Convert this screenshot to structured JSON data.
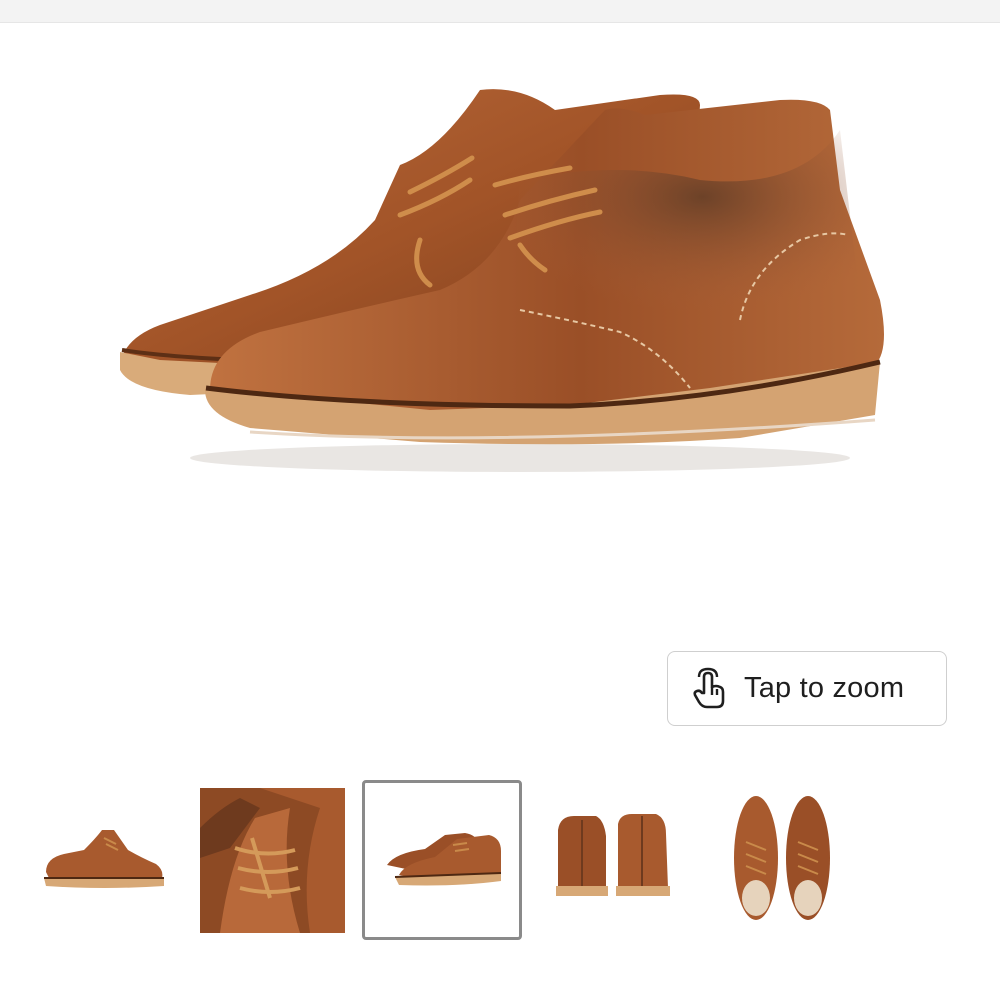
{
  "zoom_button": {
    "label": "Tap to zoom",
    "icon": "tap-gesture-icon"
  },
  "main_image": {
    "description_icon": "chukka-boots-pair-image"
  },
  "thumbnails": [
    {
      "icon": "side-view-boot-thumbnail",
      "selected": false
    },
    {
      "icon": "laces-closeup-thumbnail",
      "selected": false
    },
    {
      "icon": "pair-angle-thumbnail",
      "selected": true
    },
    {
      "icon": "back-view-thumbnail",
      "selected": false
    },
    {
      "icon": "top-view-thumbnail",
      "selected": false
    }
  ],
  "colors": {
    "leather": "#a85a2e",
    "leather_dark": "#6e3a1e",
    "sole": "#d7a876",
    "lace": "#c98a4a",
    "selected_border": "#8a8a8a"
  }
}
